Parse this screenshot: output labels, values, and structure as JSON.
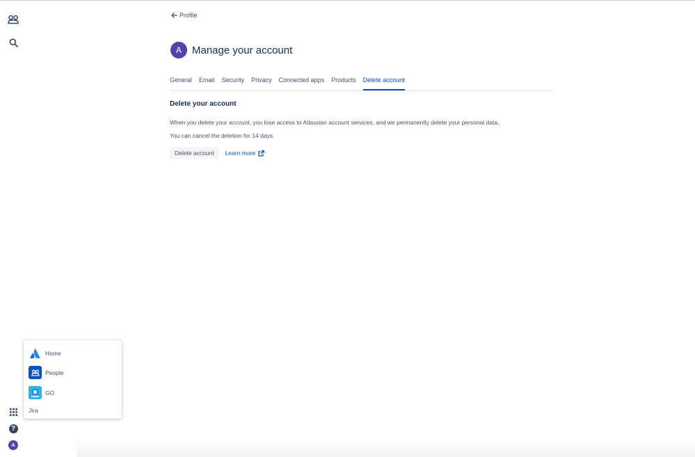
{
  "nav": {
    "icons": [
      "people-icon",
      "search-icon",
      "app-grid-icon",
      "help-icon",
      "avatar"
    ],
    "help_glyph": "?",
    "avatar_letter": "A"
  },
  "back_link": {
    "label": "Profile"
  },
  "header": {
    "avatar_letter": "A",
    "title": "Manage your account"
  },
  "tabs": [
    {
      "label": "General"
    },
    {
      "label": "Email"
    },
    {
      "label": "Security"
    },
    {
      "label": "Privacy"
    },
    {
      "label": "Connected apps"
    },
    {
      "label": "Products"
    },
    {
      "label": "Delete account"
    }
  ],
  "active_tab": "Delete account",
  "section": {
    "title": "Delete your account",
    "paragraph1": "When you delete your account, you lose access to Atlassian account services, and we permanently delete your personal data.",
    "paragraph2": "You can cancel the deletion for 14 days.",
    "delete_button": "Delete account",
    "learn_more": "Learn more"
  },
  "switcher": {
    "items": [
      {
        "label": "Home",
        "icon": "atlassian-logo-icon"
      },
      {
        "label": "People",
        "icon": "people-icon"
      },
      {
        "label": "GO",
        "icon": "go-app-icon"
      }
    ],
    "footer": "Jira"
  },
  "colors": {
    "primary": "#0052cc",
    "avatar": "#5243aa",
    "text": "#172b4d",
    "subtle_text": "#42526e"
  }
}
